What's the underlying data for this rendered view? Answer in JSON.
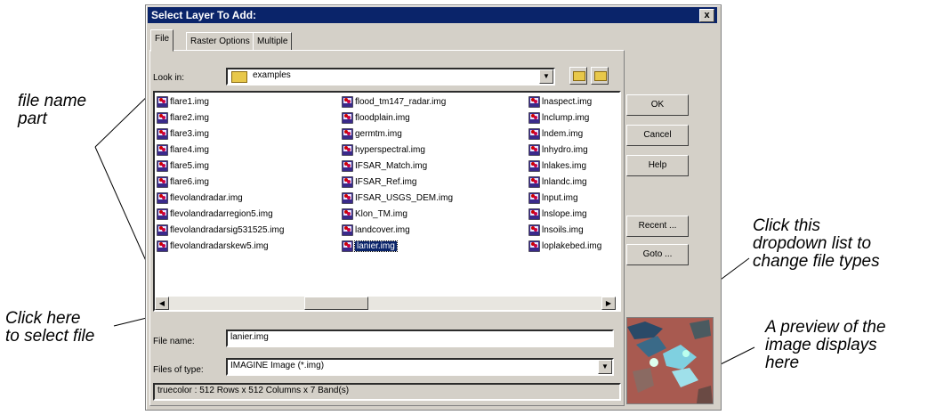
{
  "annotations": {
    "file_name_part": "file name\npart",
    "click_here": "Click here\nto select file",
    "click_dropdown": "Click this\ndropdown list to\nchange file types",
    "preview_note": "A preview of the\nimage displays\nhere"
  },
  "dialog": {
    "title": "Select Layer To Add:",
    "close_glyph": "x",
    "tabs": [
      "File",
      "Raster Options",
      "Multiple"
    ],
    "look_in_label": "Look in:",
    "look_in_value": "examples",
    "buttons": {
      "ok": "OK",
      "cancel": "Cancel",
      "help": "Help",
      "recent": "Recent ...",
      "goto": "Goto ..."
    },
    "file_name_label": "File name:",
    "file_name_value": "lanier.img",
    "file_type_label": "Files of type:",
    "file_type_value": "IMAGINE Image (*.img)",
    "status": "truecolor : 512 Rows x 512 Columns x 7 Band(s)",
    "files": {
      "col1": [
        "flare1.img",
        "flare2.img",
        "flare3.img",
        "flare4.img",
        "flare5.img",
        "flare6.img",
        "flevolandradar.img",
        "flevolandradarregion5.img",
        "flevolandradarsig531525.img",
        "flevolandradarskew5.img"
      ],
      "col2": [
        "flood_tm147_radar.img",
        "floodplain.img",
        "germtm.img",
        "hyperspectral.img",
        "IFSAR_Match.img",
        "IFSAR_Ref.img",
        "IFSAR_USGS_DEM.img",
        "Klon_TM.img",
        "landcover.img",
        "lanier.img"
      ],
      "col3": [
        "lnaspect.img",
        "lnclump.img",
        "lndem.img",
        "lnhydro.img",
        "lnlakes.img",
        "lnlandc.img",
        "lnput.img",
        "lnslope.img",
        "lnsoils.img",
        "loplakebed.img"
      ]
    },
    "selected_file": "lanier.img"
  },
  "colors": {
    "title_bar": "#0a246a",
    "selection": "#0a246a",
    "dialog_bg": "#d4d0c8"
  }
}
